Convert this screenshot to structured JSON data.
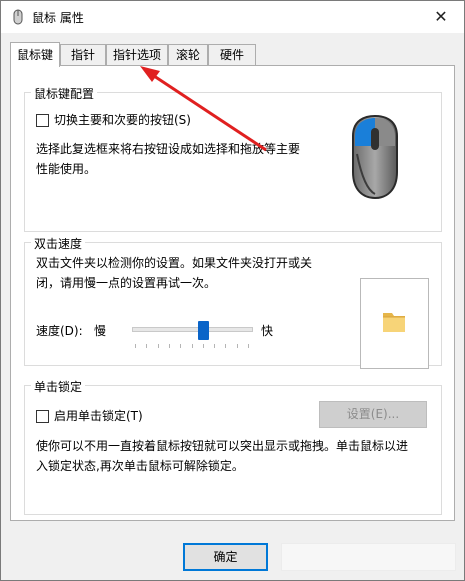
{
  "window": {
    "title": "鼠标 属性",
    "close_glyph": "✕"
  },
  "tabs": [
    {
      "label": "鼠标键"
    },
    {
      "label": "指针"
    },
    {
      "label": "指针选项"
    },
    {
      "label": "滚轮"
    },
    {
      "label": "硬件"
    }
  ],
  "button_config": {
    "group_title": "鼠标键配置",
    "checkbox_label": "切换主要和次要的按钮(S)",
    "checkbox_checked": false,
    "description_line1": "选择此复选框来将右按钮设成如选择和拖放等主要",
    "description_line2": "性能使用。"
  },
  "double_click": {
    "group_title": "双击速度",
    "description_line1": "双击文件夹以检测你的设置。如果文件夹没打开或关",
    "description_line2": "闭，请用慢一点的设置再试一次。",
    "speed_label": "速度(D):",
    "slow_label": "慢",
    "fast_label": "快",
    "slider_fraction": 0.6
  },
  "click_lock": {
    "group_title": "单击锁定",
    "checkbox_label": "启用单击锁定(T)",
    "checkbox_checked": false,
    "settings_button": "设置(E)...",
    "description_line1": "使你可以不用一直按着鼠标按钮就可以突出显示或拖拽。单击鼠标以进",
    "description_line2": "入锁定状态,再次单击鼠标可解除锁定。"
  },
  "footer": {
    "ok_button": "确定"
  },
  "colors": {
    "accent": "#0078d7",
    "arrow": "#e02020"
  },
  "icons": {
    "mouse": "mouse-icon",
    "folder": "folder-icon"
  }
}
